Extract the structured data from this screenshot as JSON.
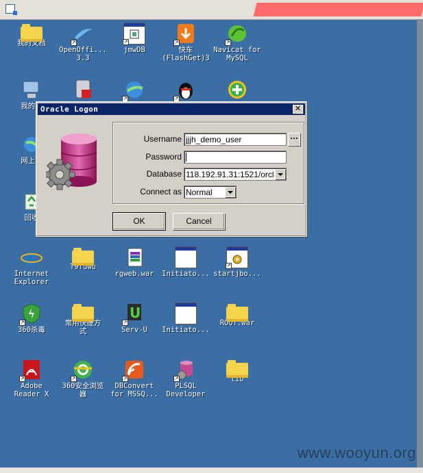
{
  "dialog": {
    "title": "Oracle Logon",
    "username_label": "Username",
    "username_value": "jjjh_demo_user",
    "password_label": "Password",
    "password_value": "",
    "database_label": "Database",
    "database_value": "118.192.91.31:1521/orcl",
    "connect_as_label": "Connect as",
    "connect_as_value": "Normal",
    "ellipsis_label": "...",
    "ok_label": "OK",
    "cancel_label": "Cancel",
    "close_label": "✕"
  },
  "desktop": {
    "icons": {
      "my_documents": "我的文档",
      "openoffice": "OpenOffi...\n3.3",
      "jmwdb": "jmwDB",
      "flashget": "快车\n(FlashGet)3",
      "navicat": "Navicat for\nMySQL",
      "my_computer": "我的电",
      "network": "网上邻",
      "recycle": "回收",
      "ie": "Internet\nExplorer",
      "t9fuwu": "T9fuwu",
      "rgweb": "rgweb.war",
      "initiato1": "Initiato...",
      "startjbo": "startjbo...",
      "antivirus360": "360杀毒",
      "shortcuts": "常用快捷方\n式",
      "servu": "Serv-U",
      "initiato2": "Initiato...",
      "rootwar": "ROOT.war",
      "adobe": "Adobe\nReader X",
      "browser360": "360安全浏览\n器",
      "dbconvert": "DBConvert\nfor MSSQ...",
      "plsql": "PLSQL\nDeveloper",
      "lib": "lib"
    }
  },
  "watermark": "www.wooyun.org",
  "colors": {
    "desktop": "#3a6ea5",
    "titlebar": "#0a246a",
    "dialog_face": "#d4d0c8"
  }
}
